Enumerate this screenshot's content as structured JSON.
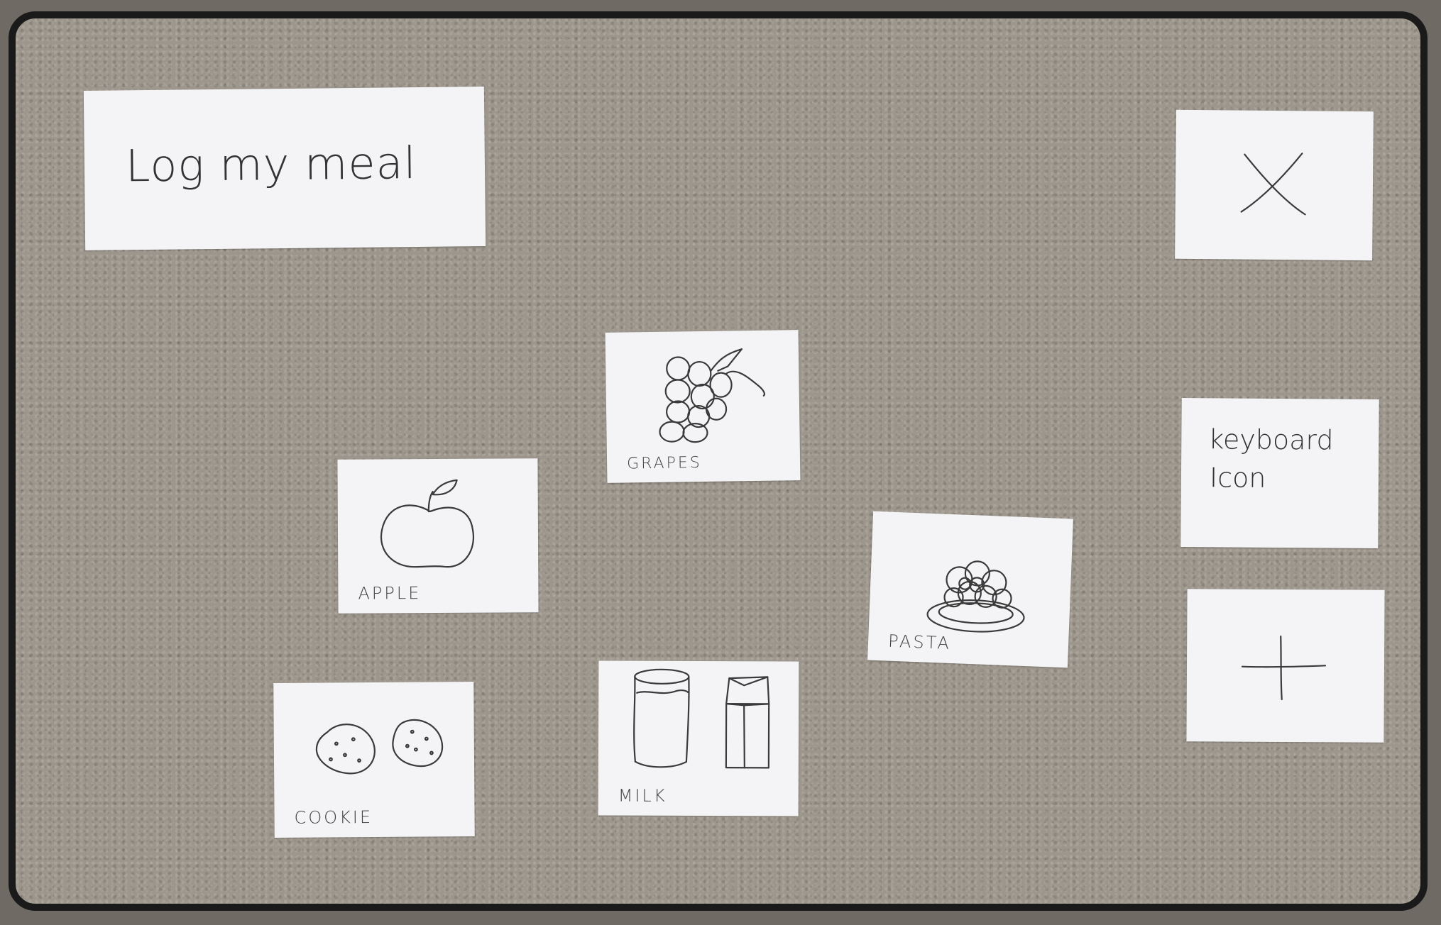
{
  "header": {
    "title": "Log my meal"
  },
  "actions": {
    "close_icon": "close-icon",
    "keyboard_label_line1": "keyboard",
    "keyboard_label_line2": "Icon",
    "add_icon": "plus-icon"
  },
  "foods": {
    "grapes": "GRAPES",
    "apple": "APPLE",
    "pasta": "PASTA",
    "cookie": "COOKIE",
    "milk": "MILK"
  },
  "colors": {
    "card": "#f4f4f6",
    "frame": "#1a1a1a",
    "ink": "#3a3a3a"
  }
}
